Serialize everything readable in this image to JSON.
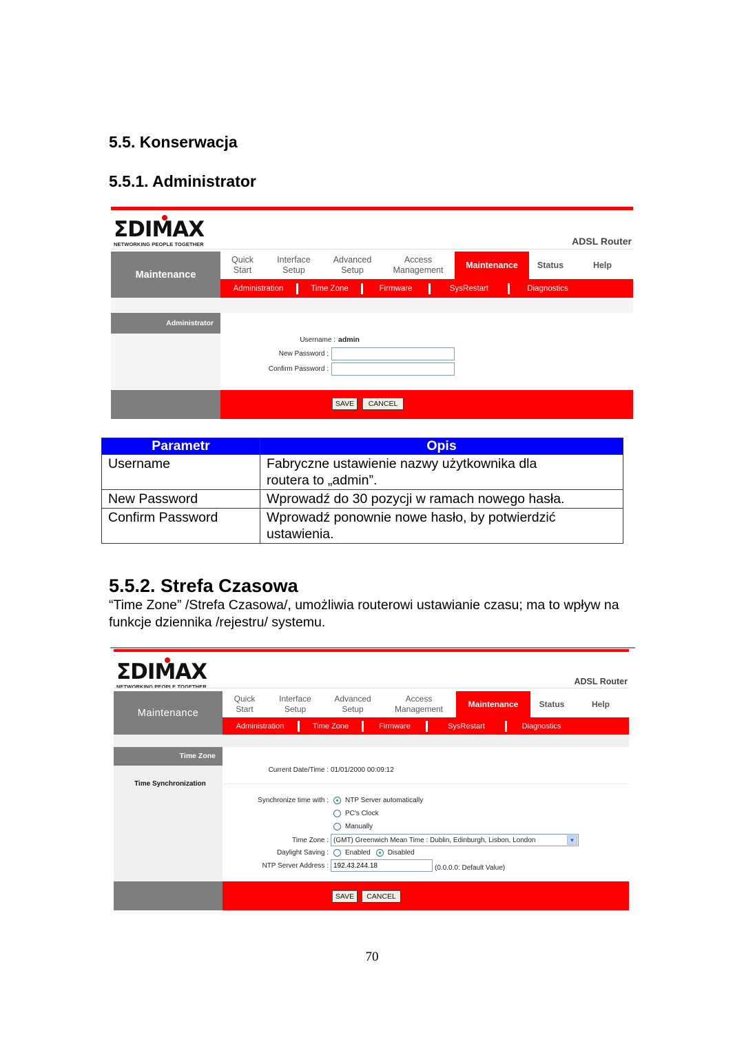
{
  "headings": {
    "section": "5.5. Konserwacja",
    "subsection_admin": "5.5.1. Administrator",
    "subsection_timezone": "5.5.2. Strefa Czasowa"
  },
  "timezone_description": "“Time Zone” /Strefa Czasowa/, umożliwia routerowi ustawianie czasu; ma to wpływ na funkcje dziennika /rejestru/ systemu.",
  "router_common": {
    "brand_colors": {
      "accent": "#ff0000",
      "sidebar": "#7f7e7f"
    },
    "logo_text": "ΣDIMAX",
    "logo_tagline": "NETWORKING PEOPLE TOGETHER",
    "product": "ADSL Router",
    "side_title": "Maintenance",
    "nav": [
      {
        "line1": "Quick",
        "line2": "Start"
      },
      {
        "line1": "Interface",
        "line2": "Setup"
      },
      {
        "line1": "Advanced",
        "line2": "Setup"
      },
      {
        "line1": "Access",
        "line2": "Management"
      },
      {
        "line1": "Maintenance",
        "line2": "",
        "active": true
      },
      {
        "line1": "Status",
        "line2": ""
      },
      {
        "line1": "Help",
        "line2": ""
      }
    ],
    "subnav": [
      "Administration",
      "Time Zone",
      "Firmware",
      "SysRestart",
      "Diagnostics"
    ],
    "save_label": "SAVE",
    "cancel_label": "CANCEL"
  },
  "admin_screen": {
    "side_header": "Administrator",
    "username_label": "Username :",
    "username_value": "admin",
    "new_password_label": "New Password :",
    "new_password_value": "",
    "confirm_password_label": "Confirm Password :",
    "confirm_password_value": ""
  },
  "param_table": {
    "headers": [
      "Parametr",
      "Opis"
    ],
    "rows": [
      {
        "param": "Username",
        "desc": "Fabryczne ustawienie nazwy użytkownika dla routera to „admin”."
      },
      {
        "param": "New Password",
        "desc": "Wprowadź do 30 pozycji w ramach nowego hasła."
      },
      {
        "param": "Confirm Password",
        "desc": "Wprowadź ponownie nowe hasło, by potwierdzić ustawienia."
      }
    ]
  },
  "timezone_screen": {
    "side_header": "Time Zone",
    "side_section": "Time Synchronization",
    "current_label": "Current Date/Time :",
    "current_value": "01/01/2000 00:09:12",
    "sync_label": "Synchronize time with :",
    "sync_options": [
      {
        "label": "NTP Server automatically",
        "selected": true
      },
      {
        "label": "PC's Clock",
        "selected": false
      },
      {
        "label": "Manually",
        "selected": false
      }
    ],
    "timezone_label": "Time Zone :",
    "timezone_value": "(GMT) Greenwich Mean Time : Dublin, Edinburgh, Lisbon, London",
    "daylight_label": "Daylight Saving :",
    "daylight_options": [
      {
        "label": "Enabled",
        "selected": false
      },
      {
        "label": "Disabled",
        "selected": true
      }
    ],
    "ntp_label": "NTP Server Address :",
    "ntp_value": "192.43.244.18",
    "ntp_hint": "(0.0.0.0: Default Value)"
  },
  "page_number": "70"
}
